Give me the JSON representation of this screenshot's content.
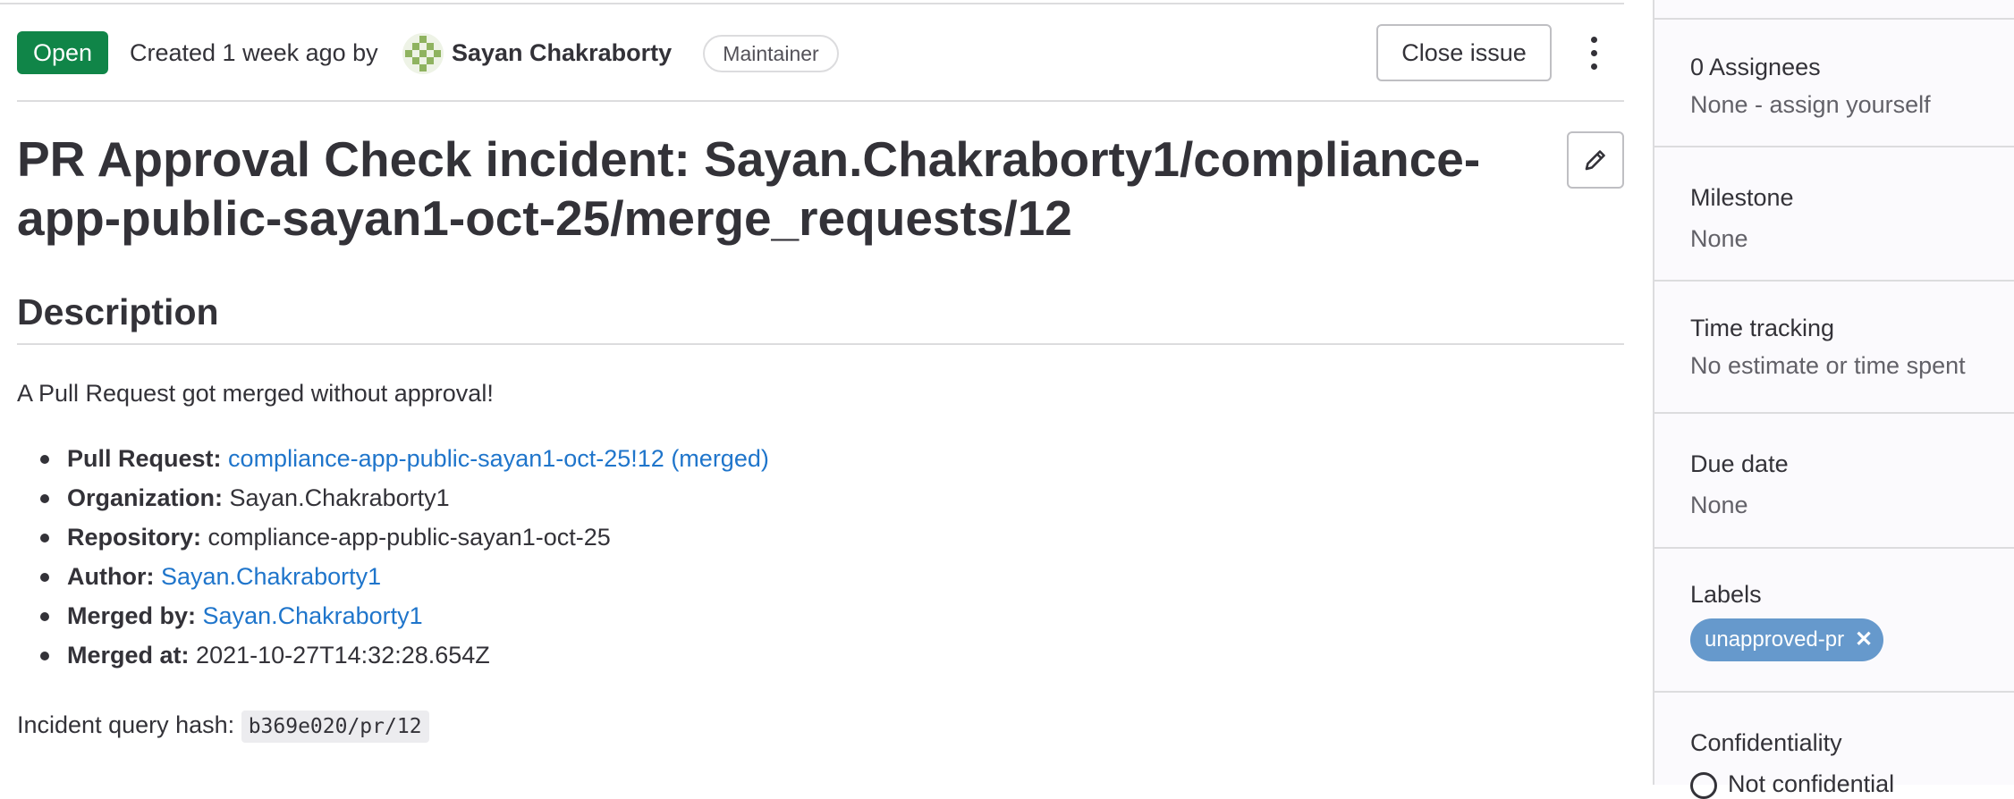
{
  "issue": {
    "status": "Open",
    "created_text": "Created 1 week ago by",
    "author": "Sayan Chakraborty",
    "author_role": "Maintainer",
    "close_label": "Close issue",
    "title": "PR Approval Check incident: Sayan.Chakraborty1/compliance-app-public-sayan1-oct-25/merge_requests/12"
  },
  "description": {
    "heading": "Description",
    "intro": "A Pull Request got merged without approval!",
    "items": [
      {
        "label": "Pull Request:",
        "value": "compliance-app-public-sayan1-oct-25!12 (merged)",
        "is_link": true
      },
      {
        "label": "Organization:",
        "value": "Sayan.Chakraborty1",
        "is_link": false
      },
      {
        "label": "Repository:",
        "value": "compliance-app-public-sayan1-oct-25",
        "is_link": false
      },
      {
        "label": "Author:",
        "value": "Sayan.Chakraborty1",
        "is_link": true
      },
      {
        "label": "Merged by:",
        "value": "Sayan.Chakraborty1",
        "is_link": true
      },
      {
        "label": "Merged at:",
        "value": "2021-10-27T14:32:28.654Z",
        "is_link": false
      }
    ],
    "hash_label": "Incident query hash:",
    "hash_value": "b369e020/pr/12"
  },
  "sidebar": {
    "assignees_title": "0 Assignees",
    "assignees_value": "None - assign yourself",
    "milestone_title": "Milestone",
    "milestone_value": "None",
    "time_title": "Time tracking",
    "time_value": "No estimate or time spent",
    "due_title": "Due date",
    "due_value": "None",
    "labels_title": "Labels",
    "label_name": "unapproved-pr",
    "label_remove": "✕",
    "confidentiality_title": "Confidentiality",
    "confidentiality_value": "Not confidential"
  },
  "colors": {
    "status_open": "#108548",
    "link": "#1f75cb",
    "label_bg": "#6699cc"
  },
  "icons": [
    "avatar",
    "kebab-menu-icon",
    "pencil-icon",
    "close-icon",
    "eye-icon"
  ]
}
